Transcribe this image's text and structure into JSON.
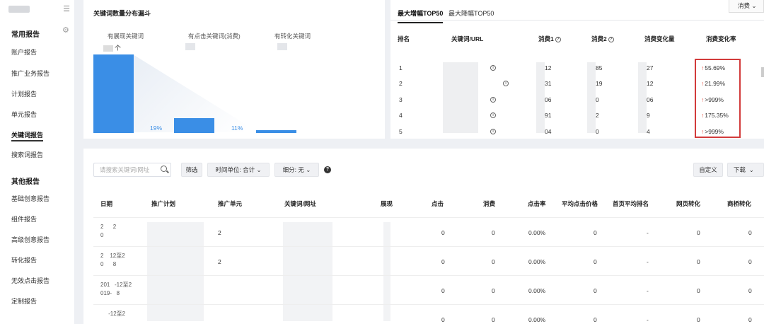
{
  "sidebar": {
    "section1": "常用报告",
    "items1": [
      "账户报告",
      "推广业务报告",
      "计划报告",
      "单元报告",
      "关键词报告",
      "搜索词报告"
    ],
    "active_index": 4,
    "section2": "其他报告",
    "items2": [
      "基础创意报告",
      "组件报告",
      "高级创意报告",
      "转化报告",
      "无效点击报告",
      "定制报告"
    ]
  },
  "funnel": {
    "title": "关键词数量分布漏斗",
    "labels": [
      "有展现关键词",
      "有点击关键词(消费)",
      "有转化关键词"
    ],
    "count_unit": "个",
    "pct1": "19%",
    "pct2": "11%"
  },
  "top": {
    "tabs": [
      "最大增幅TOP50",
      "最大降幅TOP50"
    ],
    "metric": "消费",
    "headers": [
      "排名",
      "关键词/URL",
      "消费1",
      "消费2",
      "消费变化量",
      "消费变化率"
    ],
    "rows": [
      {
        "rank": "1",
        "c1": "12",
        "c2": "85",
        "delta": "27",
        "rate": "55.69%"
      },
      {
        "rank": "2",
        "c1": "31",
        "c2": "19",
        "delta": "12",
        "rate": "21.99%"
      },
      {
        "rank": "3",
        "c1": "06",
        "c2": "0",
        "delta": "06",
        "rate": ">999%"
      },
      {
        "rank": "4",
        "c1": "91",
        "c2": "2",
        "delta": "9",
        "rate": "175.35%"
      },
      {
        "rank": "5",
        "c1": "04",
        "c2": "0",
        "delta": "4",
        "rate": ">999%"
      }
    ]
  },
  "toolbar": {
    "search_placeholder": "请搜索关键词/网址",
    "filter": "筛选",
    "time_unit": "时间单位: 合计",
    "breakdown": "细分: 无",
    "custom": "自定义",
    "download": "下载"
  },
  "table": {
    "headers": [
      "日期",
      "推广计划",
      "推广单元",
      "关键词/网址",
      "展现",
      "点击",
      "消费",
      "点击率",
      "平均点击价格",
      "首页平均排名",
      "网页转化",
      "商桥转化"
    ],
    "rows": [
      {
        "date": "2      2\n0      ",
        "unit": "2",
        "click": "0",
        "cost": "0",
        "ctr": "0.00%",
        "cpc": "0",
        "rank": "-",
        "web": "0",
        "bridge": "0"
      },
      {
        "date": "2    12至2\n0      8",
        "unit": "2",
        "click": "0",
        "cost": "0",
        "ctr": "0.00%",
        "cpc": "0",
        "rank": "-",
        "web": "0",
        "bridge": "0"
      },
      {
        "date": "201   -12至2\n019-   8",
        "unit": "",
        "click": "0",
        "cost": "0",
        "ctr": "0.00%",
        "cpc": "0",
        "rank": "-",
        "web": "0",
        "bridge": "0"
      },
      {
        "date": "     -12至2\n       ",
        "unit": "",
        "click": "0",
        "cost": "0",
        "ctr": "0.00%",
        "cpc": "0",
        "rank": "-",
        "web": "0",
        "bridge": "0"
      }
    ]
  },
  "colors": {
    "accent": "#3a8ee6",
    "highlight": "#d23b3b",
    "up": "#e74c3c"
  }
}
